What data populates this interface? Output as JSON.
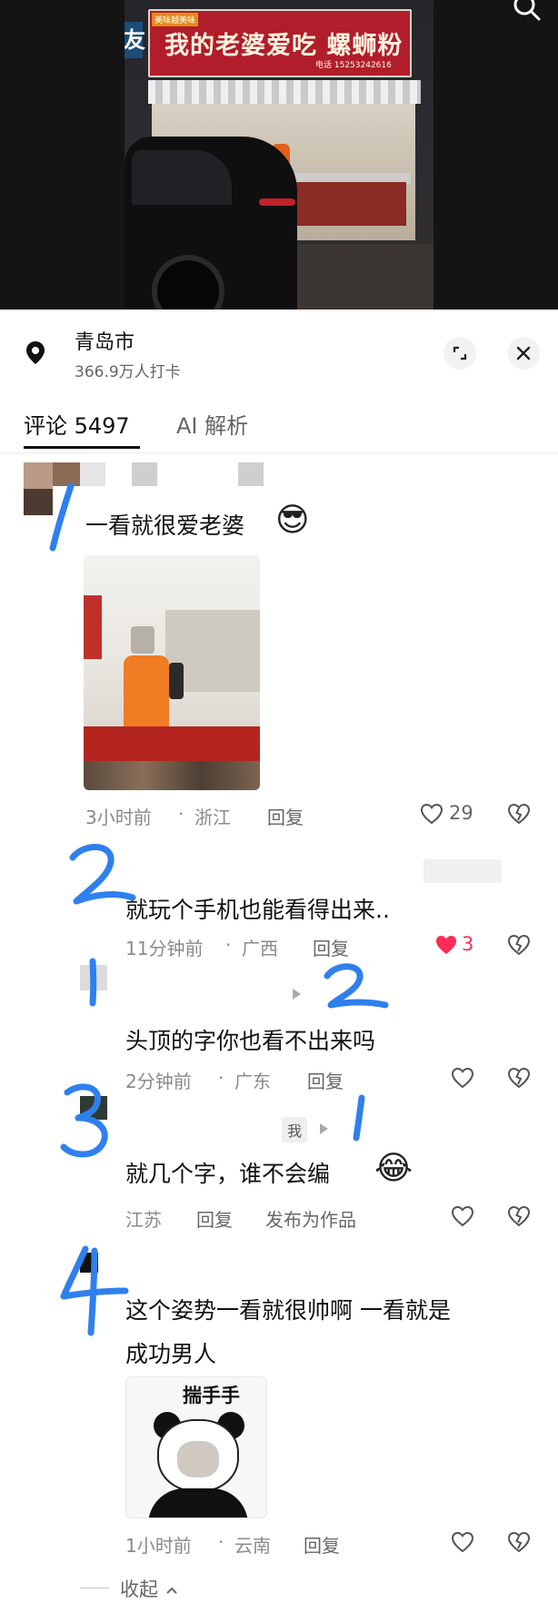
{
  "photo": {
    "sign_text": "我的老婆爱吃 螺蛳粉",
    "sign_small": "美味越美味",
    "sign_left": "友",
    "sign_phone": "电话 15253242616"
  },
  "location": {
    "city": "青岛市",
    "checkins": "366.9万人打卡"
  },
  "tabs": [
    {
      "label": "评论 5497"
    },
    {
      "label": "AI 解析"
    }
  ],
  "comments": [
    {
      "text": "一看就很爱老婆",
      "emoji": "😎",
      "time": "3小时前",
      "place": "浙江",
      "reply": "回复",
      "likes": "29",
      "liked": false
    },
    {
      "text": "就玩个手机也能看得出来..",
      "time": "11分钟前",
      "place": "广西",
      "reply": "回复",
      "likes": "3",
      "liked": true
    },
    {
      "text": "头顶的字你也看不出来吗",
      "time": "2分钟前",
      "place": "广东",
      "reply": "回复",
      "likes": "",
      "liked": false
    },
    {
      "text": "就几个字，谁不会编",
      "emoji": "😂",
      "me_tag": "我",
      "place": "江苏",
      "reply": "回复",
      "publish": "发布为作品",
      "likes": "",
      "liked": false
    },
    {
      "text_line1": "这个姿势一看就很帅啊 一看就是",
      "text_line2": "成功男人",
      "sticker_caption": "揣手手",
      "time": "1小时前",
      "place": "云南",
      "reply": "回复",
      "likes": "",
      "liked": false
    }
  ],
  "collapse_label": "收起",
  "colors": {
    "like_red": "#fe2c55",
    "ink_blue": "#2f80ed",
    "sign_red": "#b11d2a"
  }
}
